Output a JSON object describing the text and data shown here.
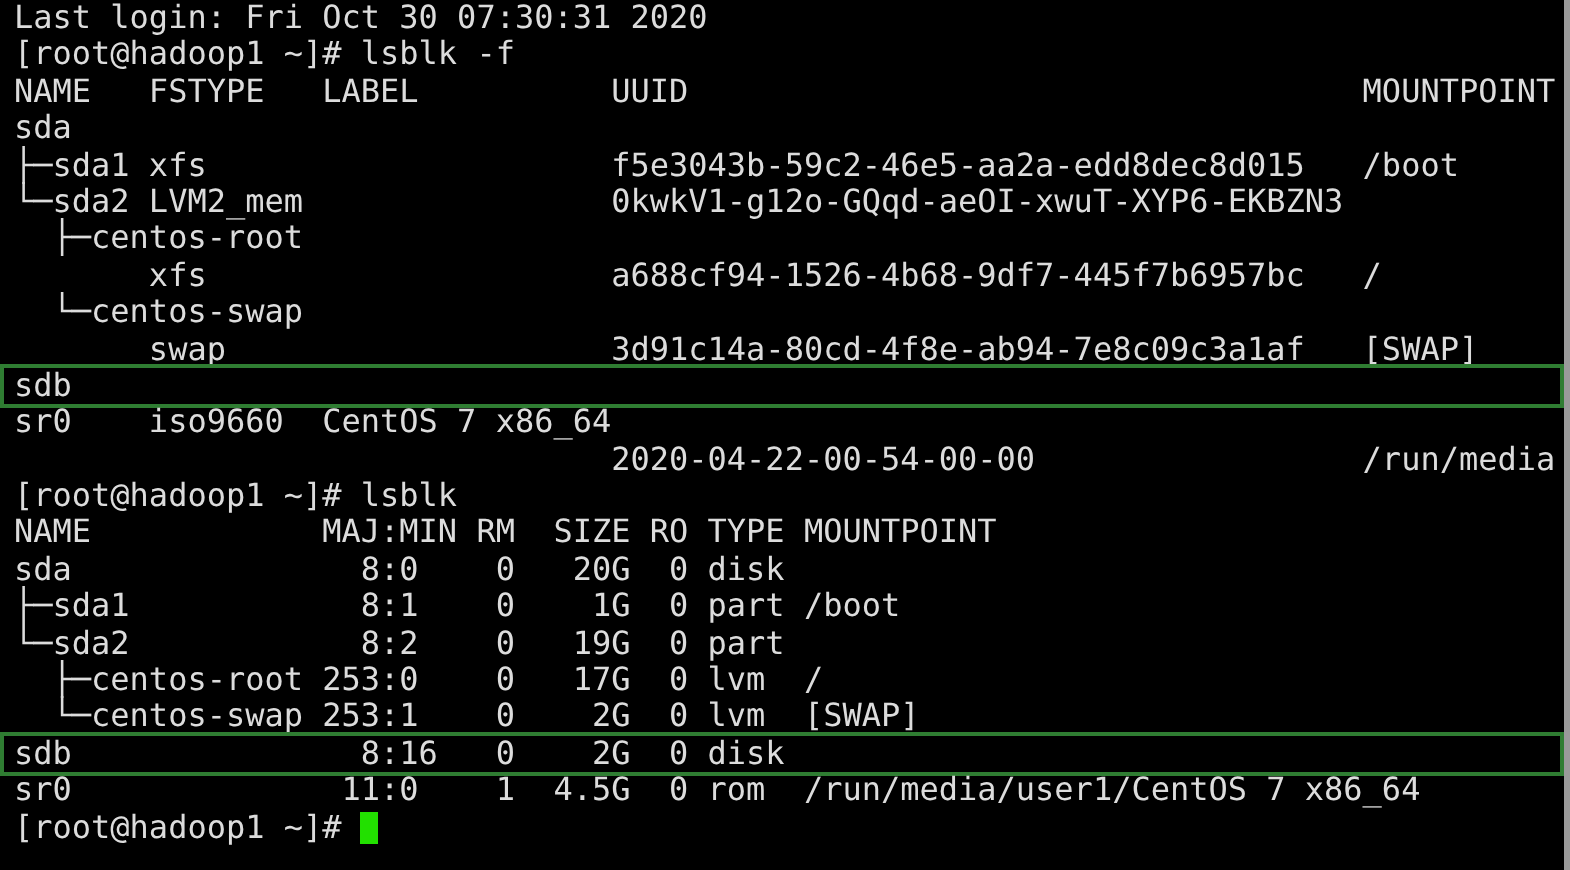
{
  "terminal": {
    "lines": [
      {
        "text": "Last login: Fri Oct 30 07:30:31 2020",
        "highlighted": false
      },
      {
        "text": "[root@hadoop1 ~]# lsblk -f",
        "highlighted": false
      },
      {
        "text": "NAME   FSTYPE   LABEL          UUID                                   MOUNTPOINT",
        "highlighted": false
      },
      {
        "text": "sda",
        "highlighted": false
      },
      {
        "text": "├─sda1 xfs                     f5e3043b-59c2-46e5-aa2a-edd8dec8d015   /boot",
        "highlighted": false
      },
      {
        "text": "└─sda2 LVM2_mem                0kwkV1-g12o-GQqd-aeOI-xwuT-XYP6-EKBZN3",
        "highlighted": false
      },
      {
        "text": "  ├─centos-root",
        "highlighted": false
      },
      {
        "text": "       xfs                     a688cf94-1526-4b68-9df7-445f7b6957bc   /",
        "highlighted": false
      },
      {
        "text": "  └─centos-swap",
        "highlighted": false
      },
      {
        "text": "       swap                    3d91c14a-80cd-4f8e-ab94-7e8c09c3a1af   [SWAP]",
        "highlighted": false
      },
      {
        "text": "sdb",
        "highlighted": true
      },
      {
        "text": "sr0    iso9660  CentOS 7 x86_64",
        "highlighted": false
      },
      {
        "text": "                               2020-04-22-00-54-00-00                 /run/media",
        "highlighted": false
      },
      {
        "text": "[root@hadoop1 ~]# lsblk",
        "highlighted": false
      },
      {
        "text": "NAME            MAJ:MIN RM  SIZE RO TYPE MOUNTPOINT",
        "highlighted": false
      },
      {
        "text": "sda               8:0    0   20G  0 disk",
        "highlighted": false
      },
      {
        "text": "├─sda1            8:1    0    1G  0 part /boot",
        "highlighted": false
      },
      {
        "text": "└─sda2            8:2    0   19G  0 part",
        "highlighted": false
      },
      {
        "text": "  ├─centos-root 253:0    0   17G  0 lvm  /",
        "highlighted": false
      },
      {
        "text": "  └─centos-swap 253:1    0    2G  0 lvm  [SWAP]",
        "highlighted": false
      },
      {
        "text": "sdb               8:16   0    2G  0 disk",
        "highlighted": true
      },
      {
        "text": "sr0              11:0    1  4.5G  0 rom  /run/media/user1/CentOS 7 x86_64",
        "highlighted": false
      },
      {
        "text": "[root@hadoop1 ~]# ",
        "highlighted": false,
        "cursor": true
      }
    ]
  }
}
